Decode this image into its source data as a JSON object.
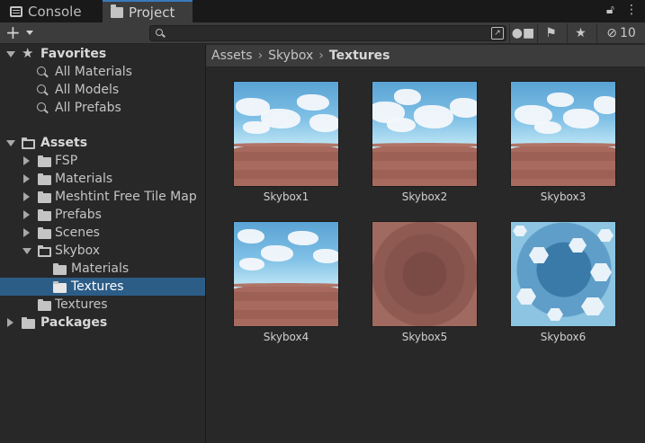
{
  "tabs": {
    "console": "Console",
    "project": "Project"
  },
  "toolbar": {
    "add_label": "+",
    "search_placeholder": "",
    "hidden_count": "10"
  },
  "tree": {
    "favorites": {
      "label": "Favorites",
      "items": [
        "All Materials",
        "All Models",
        "All Prefabs"
      ]
    },
    "assets": {
      "label": "Assets",
      "children": [
        "FSP",
        "Materials",
        "Meshtint Free Tile Map",
        "Prefabs",
        "Scenes",
        "Skybox",
        "Textures"
      ],
      "skybox_children": [
        "Materials",
        "Textures"
      ]
    },
    "packages": "Packages",
    "selected": "Assets/Skybox/Textures"
  },
  "breadcrumb": [
    "Assets",
    "Skybox",
    "Textures"
  ],
  "grid": {
    "items": [
      "Skybox1",
      "Skybox2",
      "Skybox3",
      "Skybox4",
      "Skybox5",
      "Skybox6"
    ]
  },
  "colors": {
    "selection": "#2c5d87",
    "active_tab_accent": "#3a79bb",
    "panel_bg": "#282828",
    "toolbar_bg": "#3c3c3c"
  }
}
